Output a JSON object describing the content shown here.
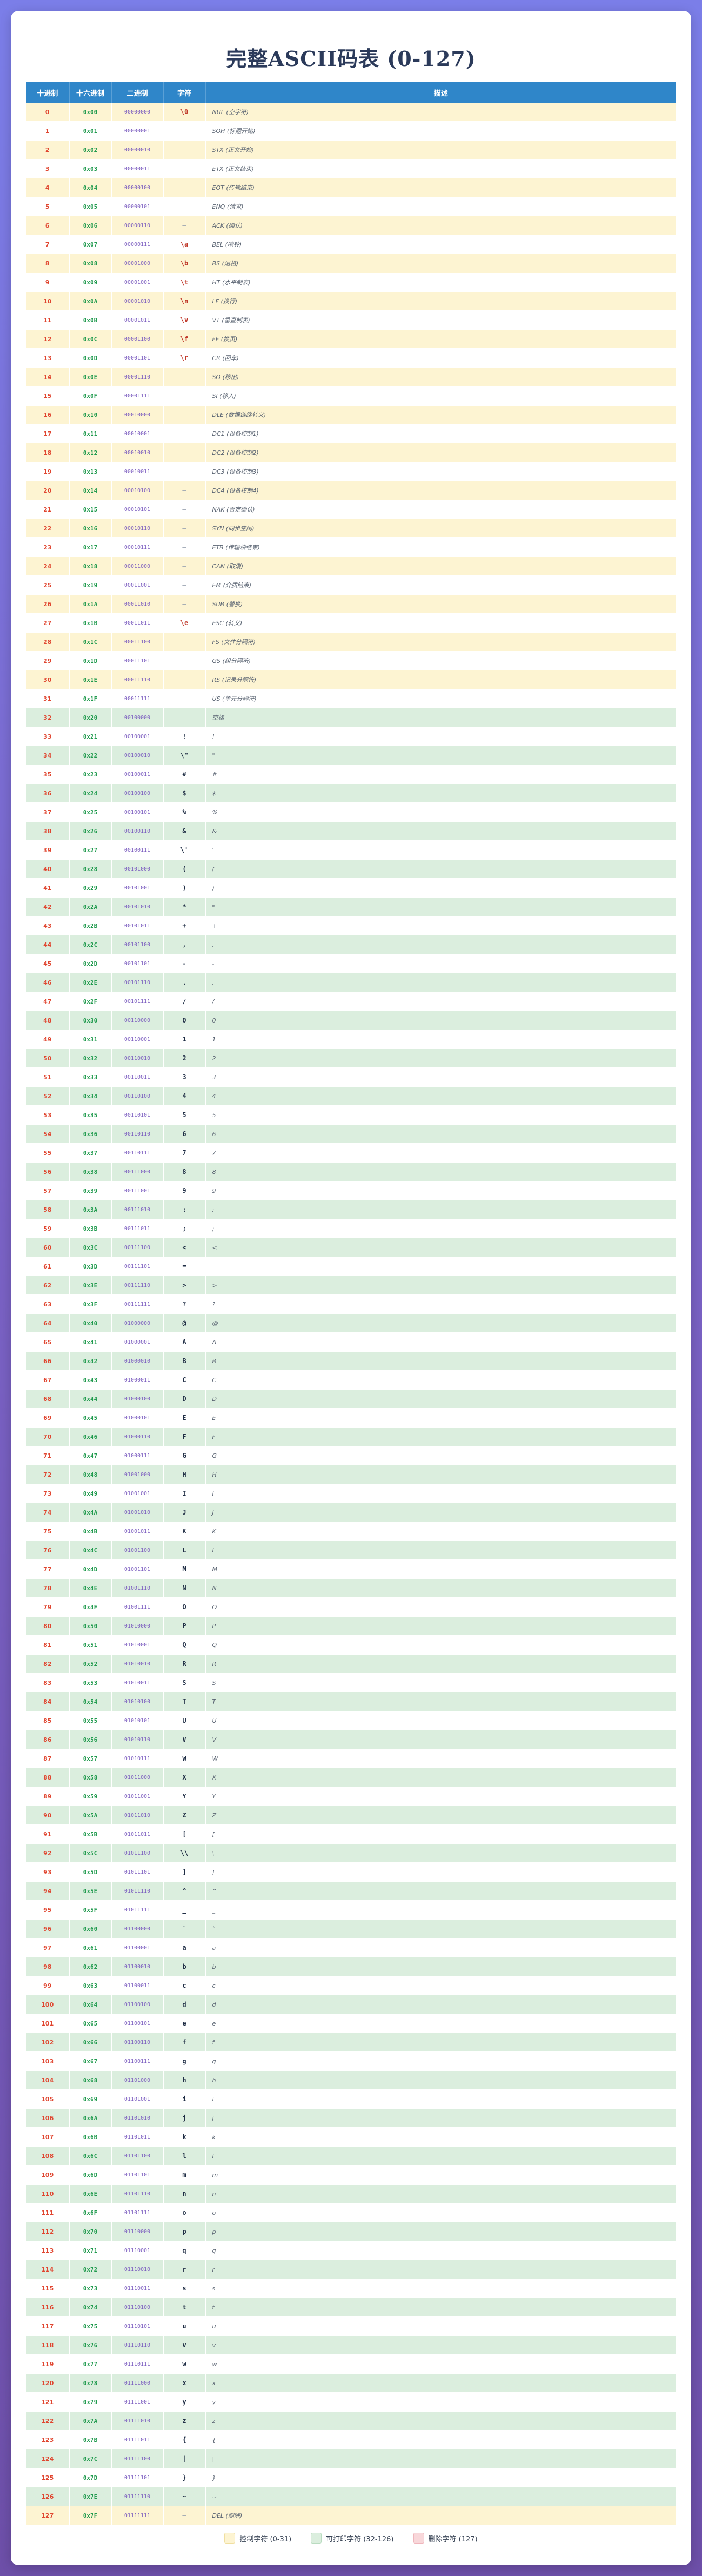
{
  "page": {
    "title": "完整ASCII码表 (0-127)"
  },
  "table": {
    "headers": [
      "十进制",
      "十六进制",
      "二进制",
      "字符",
      "描述"
    ]
  },
  "legend": [
    {
      "label": "控制字符 (0-31)",
      "color": "#fdf4d2",
      "border": "#f0dfa0"
    },
    {
      "label": "可打印字符 (32-126)",
      "color": "#dbeede",
      "border": "#b9dcc0"
    },
    {
      "label": "删除字符 (127)",
      "color": "#f8d7da",
      "border": "#efb6bc"
    }
  ],
  "control": [
    [
      "\\0",
      "NUL (空字符)"
    ],
    [
      "—",
      "SOH (标题开始)"
    ],
    [
      "—",
      "STX (正文开始)"
    ],
    [
      "—",
      "ETX (正文结束)"
    ],
    [
      "—",
      "EOT (传输结束)"
    ],
    [
      "—",
      "ENQ (请求)"
    ],
    [
      "—",
      "ACK (确认)"
    ],
    [
      "\\a",
      "BEL (响铃)"
    ],
    [
      "\\b",
      "BS (退格)"
    ],
    [
      "\\t",
      "HT (水平制表)"
    ],
    [
      "\\n",
      "LF (换行)"
    ],
    [
      "\\v",
      "VT (垂直制表)"
    ],
    [
      "\\f",
      "FF (换页)"
    ],
    [
      "\\r",
      "CR (回车)"
    ],
    [
      "—",
      "SO (移出)"
    ],
    [
      "—",
      "SI (移入)"
    ],
    [
      "—",
      "DLE (数据链路转义)"
    ],
    [
      "—",
      "DC1 (设备控制1)"
    ],
    [
      "—",
      "DC2 (设备控制2)"
    ],
    [
      "—",
      "DC3 (设备控制3)"
    ],
    [
      "—",
      "DC4 (设备控制4)"
    ],
    [
      "—",
      "NAK (否定确认)"
    ],
    [
      "—",
      "SYN (同步空闲)"
    ],
    [
      "—",
      "ETB (传输块结束)"
    ],
    [
      "—",
      "CAN (取消)"
    ],
    [
      "—",
      "EM (介质结束)"
    ],
    [
      "—",
      "SUB (替换)"
    ],
    [
      "\\e",
      "ESC (转义)"
    ],
    [
      "—",
      "FS (文件分隔符)"
    ],
    [
      "—",
      "GS (组分隔符)"
    ],
    [
      "—",
      "RS (记录分隔符)"
    ],
    [
      "—",
      "US (单元分隔符)"
    ]
  ],
  "space_desc": "空格",
  "delete_entry": [
    "—",
    "DEL (删除)"
  ]
}
